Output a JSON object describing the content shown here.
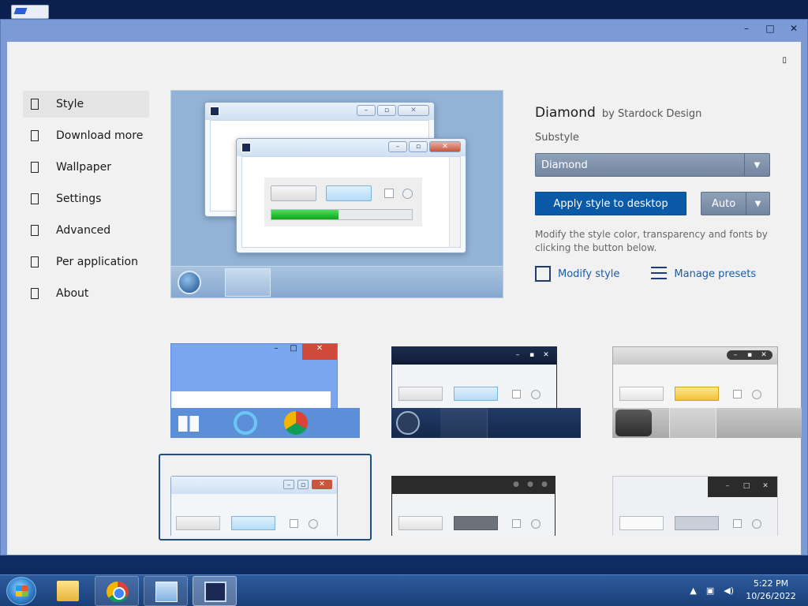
{
  "window": {
    "controls": {
      "minimize": "–",
      "maximize": "□",
      "close": "✕"
    },
    "corner_button": "▯"
  },
  "sidebar": {
    "items": [
      {
        "label": "Style",
        "icon": "style-icon",
        "active": true
      },
      {
        "label": "Download more",
        "icon": "download-icon",
        "active": false
      },
      {
        "label": "Wallpaper",
        "icon": "wallpaper-icon",
        "active": false
      },
      {
        "label": "Settings",
        "icon": "settings-icon",
        "active": false
      },
      {
        "label": "Advanced",
        "icon": "advanced-icon",
        "active": false
      },
      {
        "label": "Per application",
        "icon": "per-application-icon",
        "active": false
      },
      {
        "label": "About",
        "icon": "about-icon",
        "active": false
      }
    ]
  },
  "style_info": {
    "name": "Diamond",
    "author": "by Stardock Design",
    "substyle_label": "Substyle",
    "substyle_value": "Diamond",
    "apply_label": "Apply style to desktop",
    "auto_label": "Auto",
    "description": "Modify the style color, transparency and fonts by clicking the button below.",
    "modify_label": "Modify style",
    "presets_label": "Manage presets"
  },
  "preview": {
    "progress_fraction": 0.48
  },
  "taskbar": {
    "time": "5:22 PM",
    "date": "10/26/2022",
    "apps": [
      "folder-icon",
      "chrome-icon",
      "control-panel-icon",
      "windowblinds-icon"
    ]
  },
  "colors": {
    "accent": "#0b5aa8",
    "titlebar": "#7c9bd6",
    "select_bg": "#7f91aa"
  }
}
